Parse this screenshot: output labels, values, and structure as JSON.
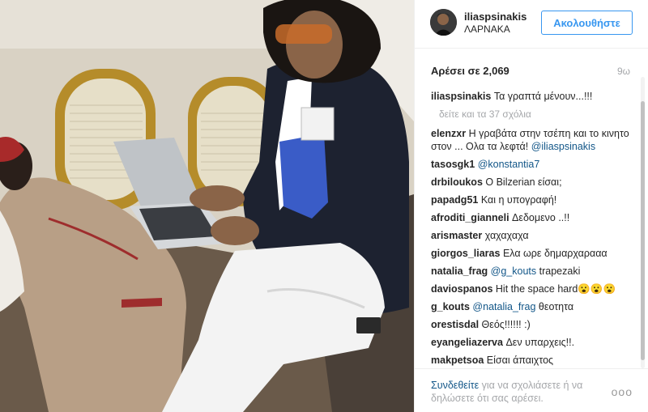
{
  "post": {
    "username": "iliaspsinakis",
    "location": "ΛΑΡΝΑΚΑ",
    "follow_label": "Ακολουθήστε",
    "likes_text": "Αρέσει σε 2,069",
    "time_ago": "9ω"
  },
  "caption": {
    "user": "iliaspsinakis",
    "text": "Τα γραπτά μένουν...!!!"
  },
  "view_more": "δείτε και τα 37 σχόλια",
  "comments": [
    {
      "user": "elenzxr",
      "text": "Η γραβάτα στην τσέπη και το κινητο στον ... Ολα τα λεφτά!",
      "mention": "@iliaspsinakis",
      "after": ""
    },
    {
      "user": "tasosgk1",
      "text": "",
      "mention": "@konstantia7",
      "after": ""
    },
    {
      "user": "drbiloukos",
      "text": "Ο Bilzerian είσαι;",
      "mention": "",
      "after": ""
    },
    {
      "user": "papadg51",
      "text": "Και η υπογραφή!",
      "mention": "",
      "after": ""
    },
    {
      "user": "afroditi_gianneli",
      "text": "Δεδομενο ..!!",
      "mention": "",
      "after": ""
    },
    {
      "user": "arismaster",
      "text": "χαχαχαχα",
      "mention": "",
      "after": ""
    },
    {
      "user": "giorgos_liaras",
      "text": "Ελα ωρε δημαρχαρααα",
      "mention": "",
      "after": ""
    },
    {
      "user": "natalia_frag",
      "text": "",
      "mention": "@g_kouts",
      "after": "trapezaki"
    },
    {
      "user": "daviospanos",
      "text": "Hit the space hard😮😮😮",
      "mention": "",
      "after": ""
    },
    {
      "user": "g_kouts",
      "text": "",
      "mention": "@natalia_frag",
      "after": "θεοτητα"
    },
    {
      "user": "orestisdal",
      "text": "Θεός!!!!!! :)",
      "mention": "",
      "after": ""
    },
    {
      "user": "eyangeliazerva",
      "text": "Δεν υπαρχεις!!.",
      "mention": "",
      "after": ""
    },
    {
      "user": "makpetsoa",
      "text": "Είσαι άπαιχτος",
      "mention": "",
      "after": ""
    }
  ],
  "footer": {
    "login_link": "Συνδεθείτε",
    "login_rest": " για να σχολιάσετε ή να δηλώσετε ότι σας αρέσει.",
    "more_options": "ooo"
  },
  "colors": {
    "accent": "#3897f0",
    "link": "#125688",
    "muted": "#a5a7aa",
    "text": "#262626"
  },
  "icons": [
    "avatar-image",
    "more-options-icon"
  ]
}
